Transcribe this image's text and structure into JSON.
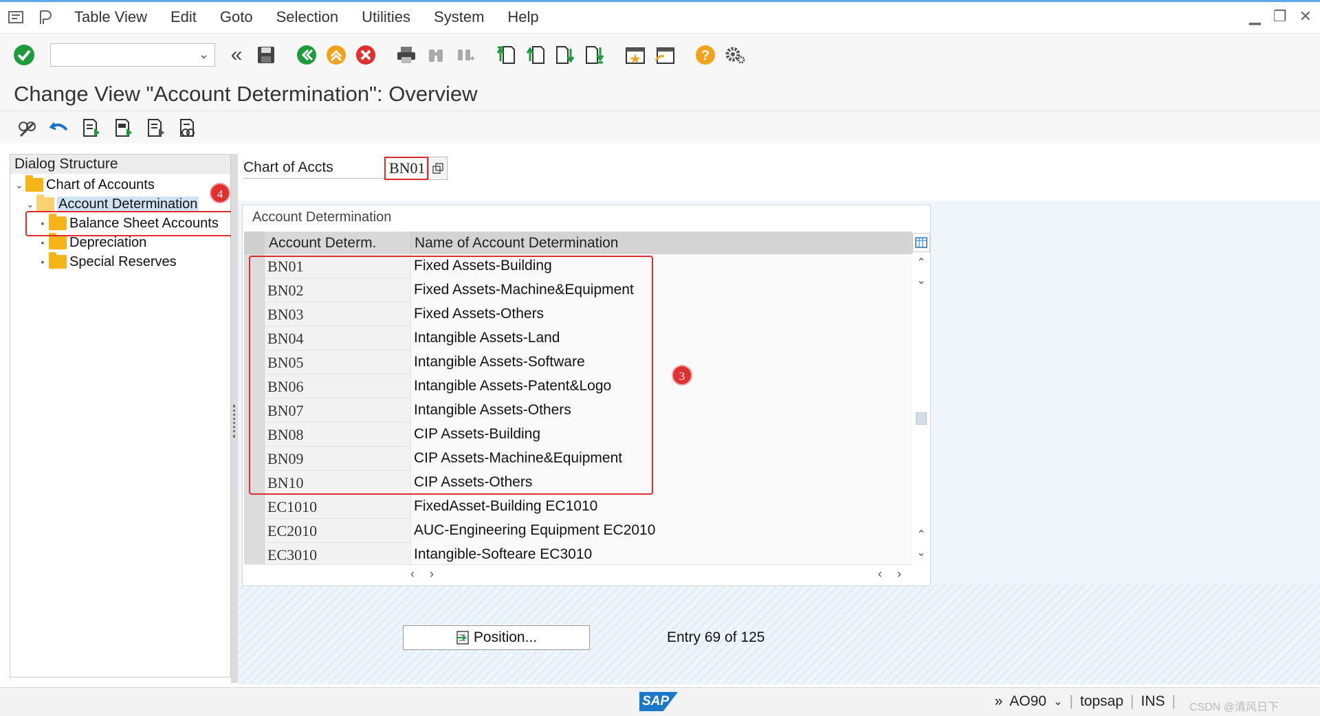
{
  "menubar": {
    "items": [
      "Table View",
      "Edit",
      "Goto",
      "Selection",
      "Utilities",
      "System",
      "Help"
    ]
  },
  "toolbar": {
    "command_field_value": ""
  },
  "title": "Change View \"Account Determination\": Overview",
  "dialog_structure": {
    "header": "Dialog Structure",
    "items": [
      {
        "label": "Chart of Accounts",
        "level": 0,
        "expanded": true
      },
      {
        "label": "Account Determination",
        "level": 1,
        "expanded": true
      },
      {
        "label": "Balance Sheet Accounts",
        "level": 2,
        "selected": true
      },
      {
        "label": "Depreciation",
        "level": 2
      },
      {
        "label": "Special Reserves",
        "level": 2
      }
    ]
  },
  "chart_of_accounts": {
    "label": "Chart of Accts",
    "value": "BN01"
  },
  "table": {
    "caption": "Account Determination",
    "columns": [
      "Account Determ.",
      "Name of Account Determination"
    ],
    "rows": [
      {
        "code": "BN01",
        "name": "Fixed Assets-Building"
      },
      {
        "code": "BN02",
        "name": "Fixed Assets-Machine&Equipment"
      },
      {
        "code": "BN03",
        "name": "Fixed Assets-Others"
      },
      {
        "code": "BN04",
        "name": "Intangible Assets-Land"
      },
      {
        "code": "BN05",
        "name": "Intangible Assets-Software"
      },
      {
        "code": "BN06",
        "name": "Intangible Assets-Patent&Logo"
      },
      {
        "code": "BN07",
        "name": "Intangible Assets-Others"
      },
      {
        "code": "BN08",
        "name": "CIP Assets-Building"
      },
      {
        "code": "BN09",
        "name": "CIP Assets-Machine&Equipment"
      },
      {
        "code": "BN10",
        "name": "CIP Assets-Others"
      },
      {
        "code": "EC1010",
        "name": "FixedAsset-Building EC1010"
      },
      {
        "code": "EC2010",
        "name": "AUC-Engineering Equipment EC2010"
      },
      {
        "code": "EC3010",
        "name": "Intangible-Softeare EC3010"
      }
    ]
  },
  "annotations": {
    "badge_table": "3",
    "badge_tree": "4"
  },
  "footer": {
    "position_button": "Position...",
    "entry_text": "Entry 69 of 125"
  },
  "statusbar": {
    "logo": "SAP",
    "transaction": "AO90",
    "server": "topsap",
    "mode": "INS",
    "watermark": "CSDN @清风日下"
  },
  "colors": {
    "accent_blue": "#1b77c9",
    "highlight_red": "#e02b2b",
    "folder": "#f6b418",
    "ok_green": "#1e9b3a"
  }
}
